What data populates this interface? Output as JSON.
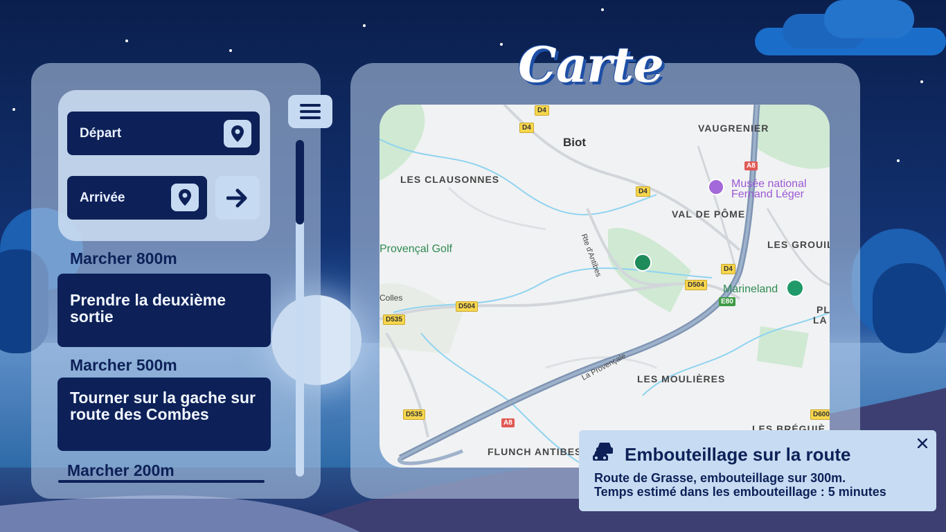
{
  "title": "Carte",
  "form": {
    "departure_label": "Départ",
    "arrival_label": "Arrivée"
  },
  "steps": [
    {
      "distance": "Marcher 800m",
      "instruction": "Prendre la deuxième sortie"
    },
    {
      "distance": "Marcher 500m",
      "instruction": "Tourner sur la gache sur route des Combes"
    },
    {
      "distance": "Marcher 200m",
      "instruction": ""
    }
  ],
  "map": {
    "labels": {
      "biot": "Biot",
      "vaugrenier": "VAUGRENIER",
      "clausonnes": "LES CLAUSONNES",
      "musee": "Musée national",
      "musee2": "Fernand Léger",
      "val_de_pome": "VAL DE PÔME",
      "grouill": "LES GROUIL",
      "provencal_golf": "Provençal Golf",
      "marineland": "Marineland",
      "colles": "Colles",
      "pl": "PL",
      "la": "LA",
      "moulieres": "LES MOULIÈRES",
      "breguieres": "LES BRÉGUIÈ",
      "flunch": "FLUNCH ANTIBES",
      "rte_antibes": "Rte d'Antibes",
      "la_provencale": "La Provençale"
    },
    "road_tags": [
      "D4",
      "D4",
      "D4",
      "D4",
      "A8",
      "A8",
      "E80",
      "D504",
      "D504",
      "D535",
      "D535",
      "D600"
    ]
  },
  "notification": {
    "title": "Embouteillage sur la route",
    "line1": "Route de Grasse, embouteillage sur 300m.",
    "line2": "Temps estimé dans les embouteillage : 5 minutes"
  },
  "colors": {
    "navy": "#0d2158",
    "panel_light": "#c6daf2",
    "sky_dark": "#0b1f4d"
  }
}
